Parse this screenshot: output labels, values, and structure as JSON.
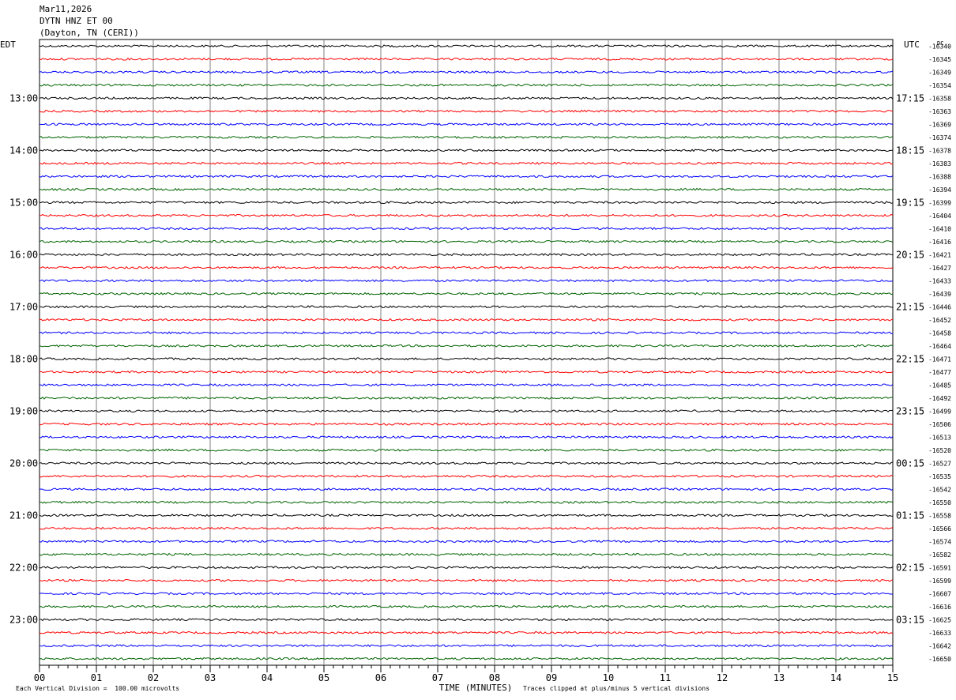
{
  "header": {
    "date": "Mar11,2026",
    "station": "DYTN HNZ ET 00",
    "location": "(Dayton, TN (CERI))"
  },
  "chart_data": {
    "type": "line",
    "left_timezone": "EDT",
    "right_timezone": "UTC",
    "dc_label": "DC",
    "xlabel": "TIME (MINUTES)",
    "x_ticks": [
      "00",
      "01",
      "02",
      "03",
      "04",
      "05",
      "06",
      "07",
      "08",
      "09",
      "10",
      "11",
      "12",
      "13",
      "14",
      "15"
    ],
    "xlim": [
      0,
      15
    ],
    "left_hour_labels": [
      "13:00",
      "14:00",
      "15:00",
      "16:00",
      "17:00",
      "18:00",
      "19:00",
      "20:00",
      "21:00",
      "22:00",
      "23:00"
    ],
    "right_hour_labels": [
      "17:15",
      "18:15",
      "19:15",
      "20:15",
      "21:15",
      "22:15",
      "23:15",
      "00:15",
      "01:15",
      "02:15",
      "03:15"
    ],
    "trace_colors": [
      "#000000",
      "#ff0000",
      "#0000ff",
      "#006400"
    ],
    "dc_offsets": [
      -16340,
      -16345,
      -16349,
      -16354,
      -16358,
      -16363,
      -16369,
      -16374,
      -16378,
      -16383,
      -16388,
      -16394,
      -16399,
      -16404,
      -16410,
      -16416,
      -16421,
      -16427,
      -16433,
      -16439,
      -16446,
      -16452,
      -16458,
      -16464,
      -16471,
      -16477,
      -16485,
      -16492,
      -16499,
      -16506,
      -16513,
      -16520,
      -16527,
      -16535,
      -16542,
      -16550,
      -16558,
      -16566,
      -16574,
      -16582,
      -16591,
      -16599,
      -16607,
      -16616,
      -16625,
      -16633,
      -16642,
      -16650
    ],
    "footer_scale": "Each Vertical Division =  100.00 microvolts",
    "footer_clip": "Traces clipped at plus/minus 5 vertical divisions"
  }
}
